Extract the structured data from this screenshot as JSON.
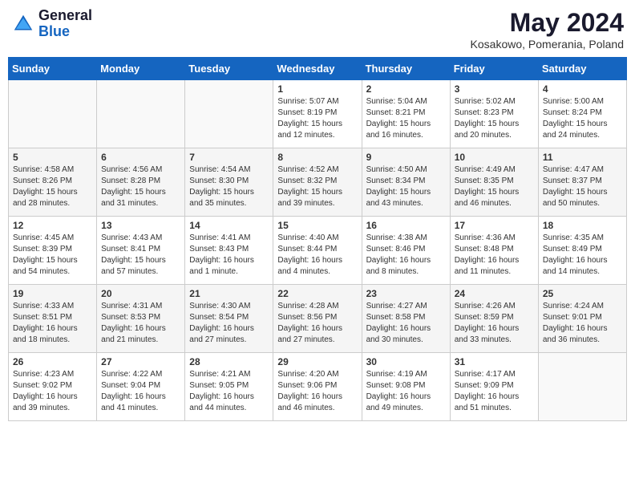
{
  "header": {
    "logo_general": "General",
    "logo_blue": "Blue",
    "month_year": "May 2024",
    "location": "Kosakowo, Pomerania, Poland"
  },
  "weekdays": [
    "Sunday",
    "Monday",
    "Tuesday",
    "Wednesday",
    "Thursday",
    "Friday",
    "Saturday"
  ],
  "weeks": [
    [
      {
        "day": "",
        "info": ""
      },
      {
        "day": "",
        "info": ""
      },
      {
        "day": "",
        "info": ""
      },
      {
        "day": "1",
        "info": "Sunrise: 5:07 AM\nSunset: 8:19 PM\nDaylight: 15 hours\nand 12 minutes."
      },
      {
        "day": "2",
        "info": "Sunrise: 5:04 AM\nSunset: 8:21 PM\nDaylight: 15 hours\nand 16 minutes."
      },
      {
        "day": "3",
        "info": "Sunrise: 5:02 AM\nSunset: 8:23 PM\nDaylight: 15 hours\nand 20 minutes."
      },
      {
        "day": "4",
        "info": "Sunrise: 5:00 AM\nSunset: 8:24 PM\nDaylight: 15 hours\nand 24 minutes."
      }
    ],
    [
      {
        "day": "5",
        "info": "Sunrise: 4:58 AM\nSunset: 8:26 PM\nDaylight: 15 hours\nand 28 minutes."
      },
      {
        "day": "6",
        "info": "Sunrise: 4:56 AM\nSunset: 8:28 PM\nDaylight: 15 hours\nand 31 minutes."
      },
      {
        "day": "7",
        "info": "Sunrise: 4:54 AM\nSunset: 8:30 PM\nDaylight: 15 hours\nand 35 minutes."
      },
      {
        "day": "8",
        "info": "Sunrise: 4:52 AM\nSunset: 8:32 PM\nDaylight: 15 hours\nand 39 minutes."
      },
      {
        "day": "9",
        "info": "Sunrise: 4:50 AM\nSunset: 8:34 PM\nDaylight: 15 hours\nand 43 minutes."
      },
      {
        "day": "10",
        "info": "Sunrise: 4:49 AM\nSunset: 8:35 PM\nDaylight: 15 hours\nand 46 minutes."
      },
      {
        "day": "11",
        "info": "Sunrise: 4:47 AM\nSunset: 8:37 PM\nDaylight: 15 hours\nand 50 minutes."
      }
    ],
    [
      {
        "day": "12",
        "info": "Sunrise: 4:45 AM\nSunset: 8:39 PM\nDaylight: 15 hours\nand 54 minutes."
      },
      {
        "day": "13",
        "info": "Sunrise: 4:43 AM\nSunset: 8:41 PM\nDaylight: 15 hours\nand 57 minutes."
      },
      {
        "day": "14",
        "info": "Sunrise: 4:41 AM\nSunset: 8:43 PM\nDaylight: 16 hours\nand 1 minute."
      },
      {
        "day": "15",
        "info": "Sunrise: 4:40 AM\nSunset: 8:44 PM\nDaylight: 16 hours\nand 4 minutes."
      },
      {
        "day": "16",
        "info": "Sunrise: 4:38 AM\nSunset: 8:46 PM\nDaylight: 16 hours\nand 8 minutes."
      },
      {
        "day": "17",
        "info": "Sunrise: 4:36 AM\nSunset: 8:48 PM\nDaylight: 16 hours\nand 11 minutes."
      },
      {
        "day": "18",
        "info": "Sunrise: 4:35 AM\nSunset: 8:49 PM\nDaylight: 16 hours\nand 14 minutes."
      }
    ],
    [
      {
        "day": "19",
        "info": "Sunrise: 4:33 AM\nSunset: 8:51 PM\nDaylight: 16 hours\nand 18 minutes."
      },
      {
        "day": "20",
        "info": "Sunrise: 4:31 AM\nSunset: 8:53 PM\nDaylight: 16 hours\nand 21 minutes."
      },
      {
        "day": "21",
        "info": "Sunrise: 4:30 AM\nSunset: 8:54 PM\nDaylight: 16 hours\nand 27 minutes."
      },
      {
        "day": "22",
        "info": "Sunrise: 4:28 AM\nSunset: 8:56 PM\nDaylight: 16 hours\nand 27 minutes."
      },
      {
        "day": "23",
        "info": "Sunrise: 4:27 AM\nSunset: 8:58 PM\nDaylight: 16 hours\nand 30 minutes."
      },
      {
        "day": "24",
        "info": "Sunrise: 4:26 AM\nSunset: 8:59 PM\nDaylight: 16 hours\nand 33 minutes."
      },
      {
        "day": "25",
        "info": "Sunrise: 4:24 AM\nSunset: 9:01 PM\nDaylight: 16 hours\nand 36 minutes."
      }
    ],
    [
      {
        "day": "26",
        "info": "Sunrise: 4:23 AM\nSunset: 9:02 PM\nDaylight: 16 hours\nand 39 minutes."
      },
      {
        "day": "27",
        "info": "Sunrise: 4:22 AM\nSunset: 9:04 PM\nDaylight: 16 hours\nand 41 minutes."
      },
      {
        "day": "28",
        "info": "Sunrise: 4:21 AM\nSunset: 9:05 PM\nDaylight: 16 hours\nand 44 minutes."
      },
      {
        "day": "29",
        "info": "Sunrise: 4:20 AM\nSunset: 9:06 PM\nDaylight: 16 hours\nand 46 minutes."
      },
      {
        "day": "30",
        "info": "Sunrise: 4:19 AM\nSunset: 9:08 PM\nDaylight: 16 hours\nand 49 minutes."
      },
      {
        "day": "31",
        "info": "Sunrise: 4:17 AM\nSunset: 9:09 PM\nDaylight: 16 hours\nand 51 minutes."
      },
      {
        "day": "",
        "info": ""
      }
    ]
  ]
}
